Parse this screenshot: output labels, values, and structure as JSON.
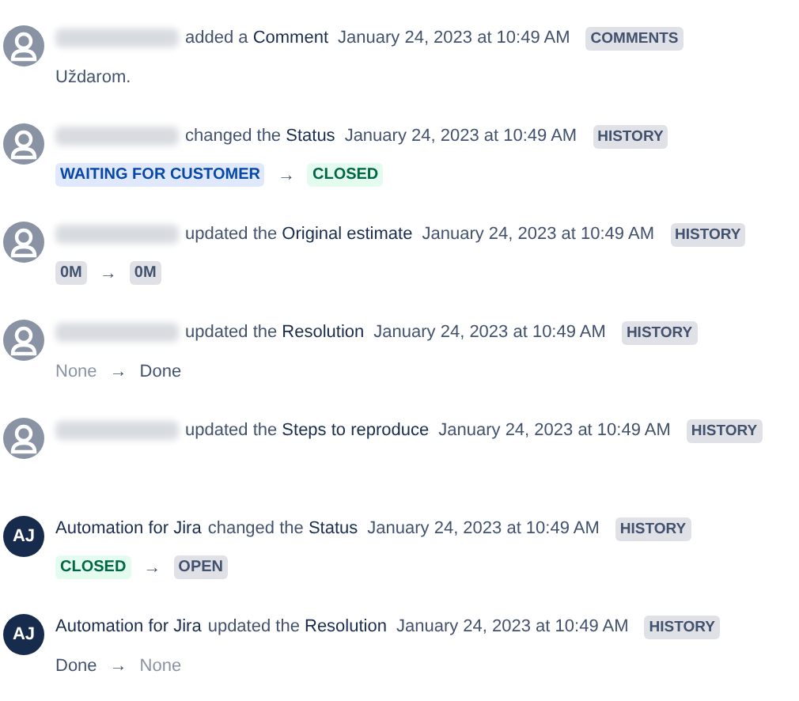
{
  "entries": [
    {
      "avatar": {
        "kind": "silhouette"
      },
      "author_redacted": true,
      "action": "added a **Comment**",
      "time": "January 24, 2023 at 10:49 AM",
      "tag": "COMMENTS",
      "detail": {
        "kind": "text",
        "text": "Uždarom."
      }
    },
    {
      "avatar": {
        "kind": "silhouette"
      },
      "author_redacted": true,
      "action": "changed the **Status**",
      "time": "January 24, 2023 at 10:49 AM",
      "tag": "HISTORY",
      "detail": {
        "kind": "change",
        "from": {
          "text": "WAITING FOR CUSTOMER",
          "kind": "lozenge",
          "color": "#0747a6"
        },
        "arrow": "→",
        "to": {
          "text": "CLOSED",
          "kind": "lozenge",
          "color": "#006644"
        }
      }
    },
    {
      "avatar": {
        "kind": "silhouette"
      },
      "author_redacted": true,
      "action": "updated the **Original estimate**",
      "time": "January 24, 2023 at 10:49 AM",
      "tag": "HISTORY",
      "detail": {
        "kind": "change",
        "from": {
          "text": "0M",
          "kind": "lozenge",
          "color": "#42526e"
        },
        "arrow": "→",
        "to": {
          "text": "0M",
          "kind": "lozenge",
          "color": "#42526e"
        }
      }
    },
    {
      "avatar": {
        "kind": "silhouette"
      },
      "author_redacted": true,
      "action": "updated the **Resolution**",
      "time": "January 24, 2023 at 10:49 AM",
      "tag": "HISTORY",
      "detail": {
        "kind": "change",
        "from": {
          "text": "None",
          "kind": "plain",
          "color": "#8993a4"
        },
        "arrow": "→",
        "to": {
          "text": "Done",
          "kind": "plain",
          "color": "#42526e"
        }
      }
    },
    {
      "avatar": {
        "kind": "silhouette"
      },
      "author_redacted": true,
      "action": "updated the **Steps to reproduce**",
      "time": "January 24, 2023 at 10:49 AM",
      "tag": "HISTORY"
    },
    {
      "avatar": {
        "kind": "initials",
        "initials": "AJ"
      },
      "author_redacted": false,
      "author": "Automation for Jira",
      "action": "changed the **Status**",
      "time": "January 24, 2023 at 10:49 AM",
      "tag": "HISTORY",
      "detail": {
        "kind": "change",
        "from": {
          "text": "CLOSED",
          "kind": "lozenge",
          "color": "#006644"
        },
        "arrow": "→",
        "to": {
          "text": "OPEN",
          "kind": "lozenge",
          "color": "#42526e"
        }
      }
    },
    {
      "avatar": {
        "kind": "initials",
        "initials": "AJ"
      },
      "author_redacted": false,
      "author": "Automation for Jira",
      "action": "updated the **Resolution**",
      "time": "January 24, 2023 at 10:49 AM",
      "tag": "HISTORY",
      "detail": {
        "kind": "change",
        "from": {
          "text": "Done",
          "kind": "plain",
          "color": "#42526e"
        },
        "arrow": "→",
        "to": {
          "text": "None",
          "kind": "plain",
          "color": "#8993a4"
        }
      }
    }
  ]
}
